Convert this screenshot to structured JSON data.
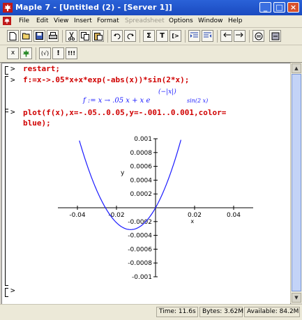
{
  "window": {
    "title": "Maple 7 - [Untitled (2) - [Server 1]]",
    "buttons": [
      "minimize",
      "maximize",
      "close"
    ]
  },
  "menu": [
    {
      "label": "File",
      "enabled": true
    },
    {
      "label": "Edit",
      "enabled": true
    },
    {
      "label": "View",
      "enabled": true
    },
    {
      "label": "Insert",
      "enabled": true
    },
    {
      "label": "Format",
      "enabled": true
    },
    {
      "label": "Spreadsheet",
      "enabled": false
    },
    {
      "label": "Options",
      "enabled": true
    },
    {
      "label": "Window",
      "enabled": true
    },
    {
      "label": "Help",
      "enabled": true
    }
  ],
  "toolbar": {
    "text_T": "T",
    "text_sigma": "Σ",
    "text_gt": "[>",
    "text_x": "x",
    "text_bang": "!",
    "text_bangs": "!!!",
    "text_func": "(√)"
  },
  "worksheet": {
    "commands": [
      {
        "prompt": ">",
        "input": "restart;"
      },
      {
        "prompt": ">",
        "input": "f:=x->.05*x+x*exp(-abs(x))*sin(2*x);"
      },
      {
        "prompt": ">",
        "input": "plot(f(x),x=-.05..0.05,y=-.001..0.001,color=\nblue);"
      }
    ],
    "output_lhs": "f := x → .05 x + x e",
    "output_exp": "(−|x|)",
    "output_sin": "sin(2 x)",
    "empty_prompt": "[>"
  },
  "chart_data": {
    "type": "line",
    "title": "",
    "xlabel": "x",
    "ylabel": "y",
    "xlim": [
      -0.05,
      0.05
    ],
    "ylim": [
      -0.001,
      0.001
    ],
    "x_ticks": [
      "-0.04",
      "-0.02",
      "0.02",
      "0.04"
    ],
    "y_ticks": [
      "0.001",
      "0.0008",
      "0.0006",
      "0.0004",
      "0.0002",
      "-0.0002",
      "-0.0004",
      "-0.0006",
      "-0.0008",
      "-0.001"
    ],
    "series": [
      {
        "color": "#1a1aff",
        "x": [
          -0.05,
          -0.045,
          -0.04,
          -0.035,
          -0.03,
          -0.025,
          -0.02,
          -0.015,
          -0.01,
          -0.005,
          0,
          0.005,
          0.01,
          0.015,
          0.02,
          0.025,
          0.03,
          0.035,
          0.04,
          0.045,
          0.05
        ],
        "y": null
      }
    ],
    "grid": false,
    "legend": "none"
  },
  "status": {
    "time": "Time: 11.6s",
    "bytes": "Bytes: 3.62M",
    "available": "Available: 84.2M"
  }
}
